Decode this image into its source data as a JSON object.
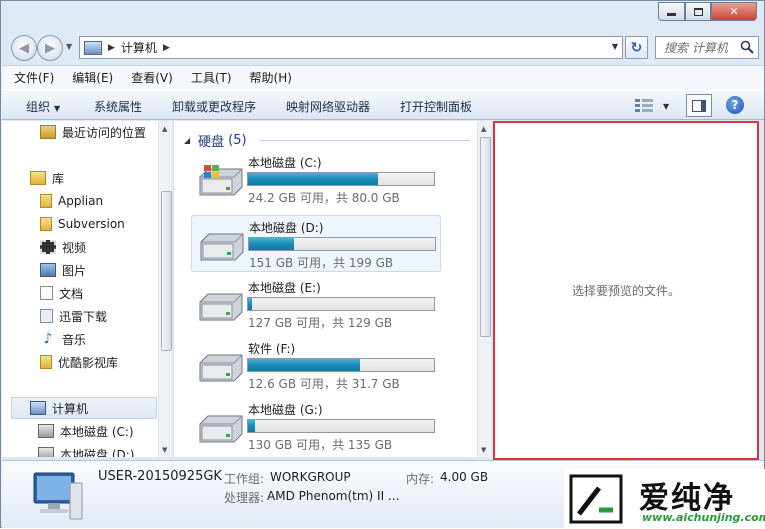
{
  "address": {
    "path": "计算机"
  },
  "search": {
    "placeholder": "搜索 计算机"
  },
  "menu": [
    "文件(F)",
    "编辑(E)",
    "查看(V)",
    "工具(T)",
    "帮助(H)"
  ],
  "toolbar": {
    "organize": "组织",
    "system_properties": "系统属性",
    "uninstall": "卸载或更改程序",
    "map_drive": "映射网络驱动器",
    "control_panel": "打开控制面板"
  },
  "nav": {
    "recent": "最近访问的位置",
    "library": "库",
    "applian": "Applian",
    "subversion": "Subversion",
    "video": "视频",
    "pictures": "图片",
    "documents": "文档",
    "thunder": "迅雷下载",
    "music": "音乐",
    "youku": "优酷影视库",
    "computer": "计算机",
    "drive_c": "本地磁盘 (C:)",
    "drive_d": "本地磁盘 (D:)"
  },
  "group": {
    "title": "硬盘",
    "count": "(5)"
  },
  "drives": [
    {
      "name": "本地磁盘 (C:)",
      "info": "24.2 GB 可用，共 80.0 GB",
      "used_fraction": 0.7
    },
    {
      "name": "本地磁盘 (D:)",
      "info": "151 GB 可用，共 199 GB",
      "used_fraction": 0.24
    },
    {
      "name": "本地磁盘 (E:)",
      "info": "127 GB 可用，共 129 GB",
      "used_fraction": 0.02
    },
    {
      "name": "软件 (F:)",
      "info": "12.6 GB 可用，共 31.7 GB",
      "used_fraction": 0.6
    },
    {
      "name": "本地磁盘 (G:)",
      "info": "130 GB 可用，共 135 GB",
      "used_fraction": 0.04
    }
  ],
  "preview": {
    "message": "选择要预览的文件。"
  },
  "details": {
    "computer_name": "USER-20150925GK",
    "workgroup_label": "工作组:",
    "workgroup": "WORKGROUP",
    "memory_label": "内存:",
    "memory": "4.00 GB",
    "processor_label": "处理器:",
    "processor": "AMD Phenom(tm) II ..."
  },
  "watermark": {
    "text": "爱纯净",
    "url": "www.aichunjing.com"
  },
  "colors": {
    "progress": "#1a8bb5",
    "highlight_border": "#e0303a"
  }
}
